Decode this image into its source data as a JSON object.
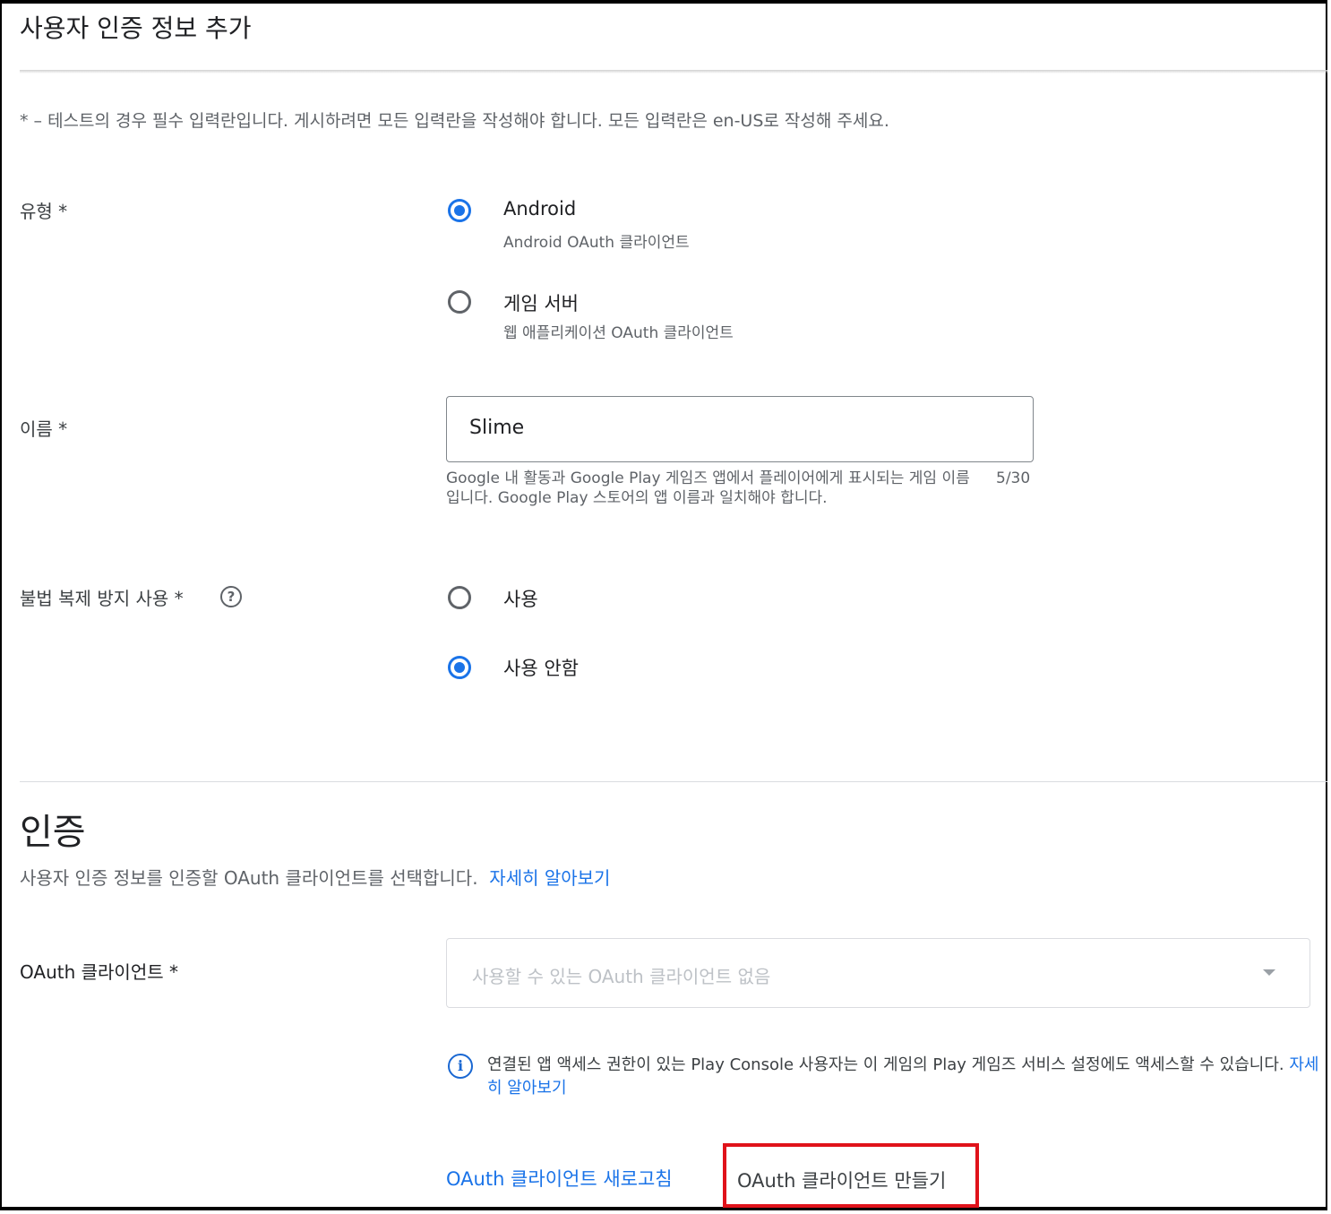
{
  "page": {
    "title": "사용자 인증 정보 추가",
    "required_note": "* – 테스트의 경우 필수 입력란입니다. 게시하려면 모든 입력란을 작성해야 합니다. 모든 입력란은 en-US로 작성해 주세요."
  },
  "type_field": {
    "label": "유형  *",
    "options": [
      {
        "label": "Android",
        "sublabel": "Android OAuth 클라이언트",
        "selected": true
      },
      {
        "label": "게임 서버",
        "sublabel": "웹 애플리케이션 OAuth 클라이언트",
        "selected": false
      }
    ]
  },
  "name_field": {
    "label": "이름  *",
    "value": "Slime",
    "helper": "Google 내 활동과 Google Play 게임즈 앱에서 플레이어에게 표시되는 게임 이름입니다. Google Play 스토어의 앱 이름과 일치해야 합니다.",
    "counter": "5/30"
  },
  "antipiracy_field": {
    "label": "불법 복제 방지 사용 *",
    "help_glyph": "?",
    "options": [
      {
        "label": "사용",
        "selected": false
      },
      {
        "label": "사용 안함",
        "selected": true
      }
    ]
  },
  "auth_section": {
    "title": "인증",
    "description": "사용자 인증 정보를 인증할 OAuth 클라이언트를 선택합니다.",
    "learn_more": "자세히 알아보기"
  },
  "oauth_field": {
    "label": "OAuth 클라이언트  *",
    "placeholder": "사용할 수 있는 OAuth 클라이언트 없음"
  },
  "info_notice": {
    "glyph": "i",
    "text": "연결된 앱 액세스 권한이 있는 Play Console 사용자는 이 게임의 Play 게임즈 서비스 설정에도 액세스할 수 있습니다.",
    "link": "자세히 알아보기"
  },
  "actions": {
    "refresh_label": "OAuth 클라이언트 새로고침",
    "create_label": "OAuth 클라이언트 만들기"
  },
  "colors": {
    "accent": "#1a73e8",
    "highlight_border": "#e0121a"
  }
}
